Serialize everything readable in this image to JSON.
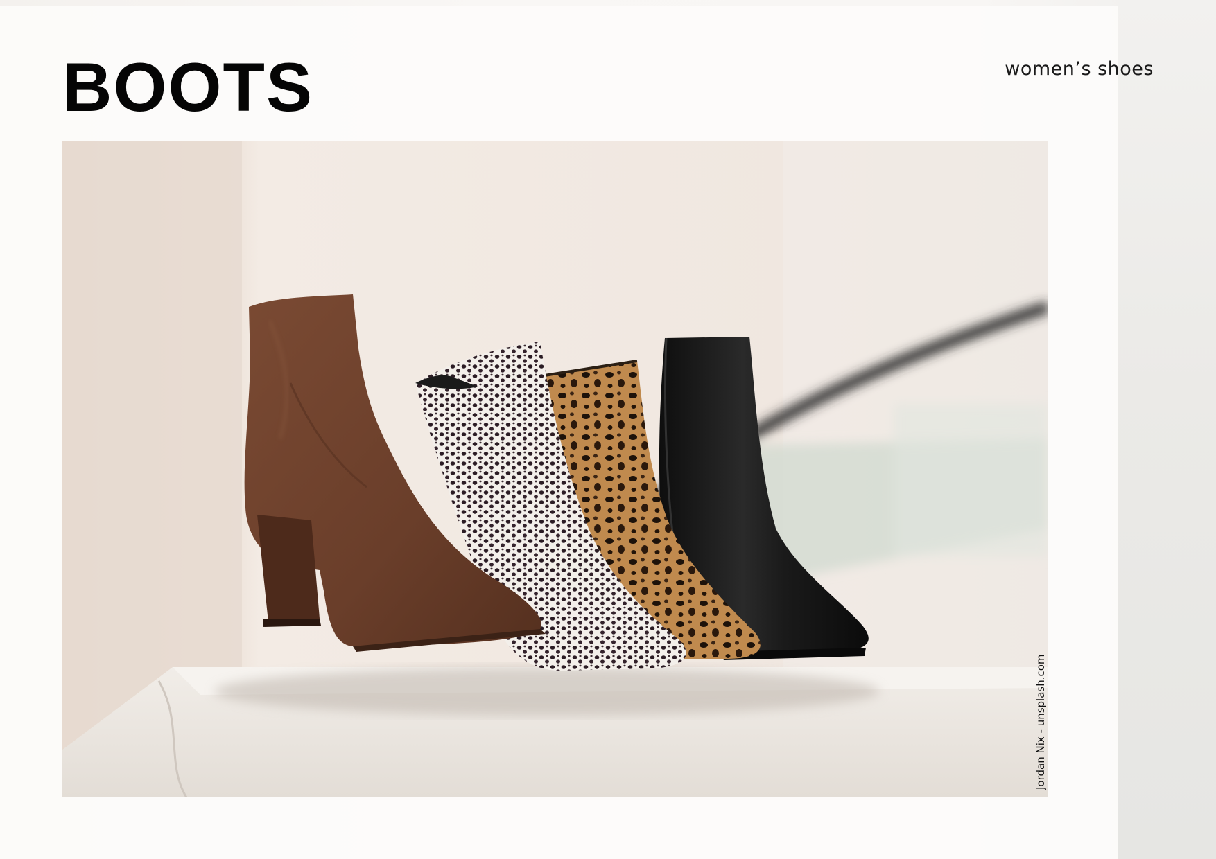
{
  "page": {
    "title": "BOOTS",
    "subtitle": "women’s shoes"
  },
  "photo": {
    "credit": "Jordan Nix - unsplash.com",
    "subject": "four ankle boots in a row: brown suede, black-and-white spotted, leopard print, black leather"
  },
  "colors": {
    "title": "#050505",
    "background": "#f7f4f1",
    "brown_suede": "#6b3f2a",
    "leopard": "#b07a42",
    "black_leather": "#151515"
  }
}
